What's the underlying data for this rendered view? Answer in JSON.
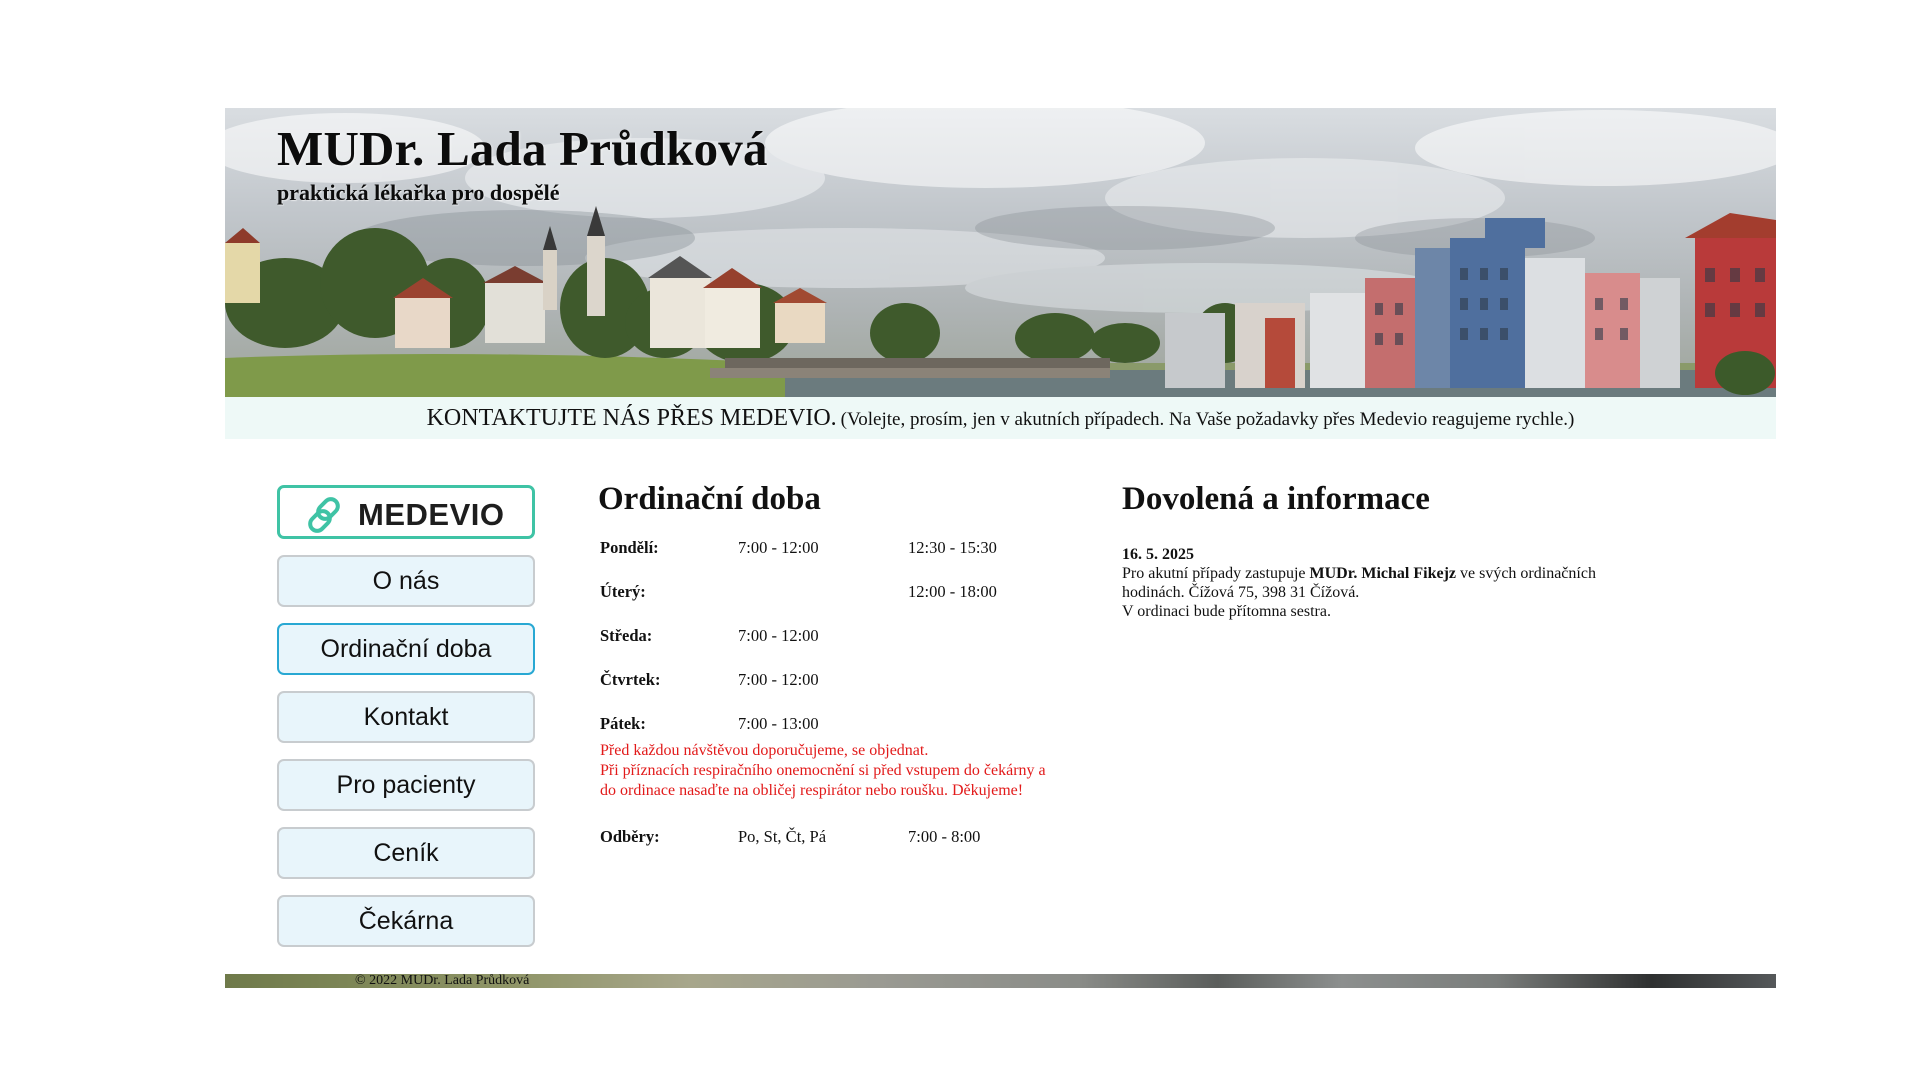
{
  "header": {
    "title": "MUDr. Lada Průdková",
    "subtitle": "praktická lékařka pro dospělé"
  },
  "contact_bar": {
    "lead": "KONTAKTUJTE NÁS PŘES MEDEVIO.",
    "note": "(Volejte, prosím, jen v akutních případech. Na Vaše požadavky přes Medevio reagujeme rychle.)"
  },
  "sidebar": {
    "medevio_label": "MEDEVIO",
    "items": [
      {
        "label": "O nás"
      },
      {
        "label": "Ordinační doba",
        "active": true
      },
      {
        "label": "Kontakt"
      },
      {
        "label": "Pro pacienty"
      },
      {
        "label": "Ceník"
      },
      {
        "label": "Čekárna"
      }
    ]
  },
  "hours": {
    "heading": "Ordinační doba",
    "rows": [
      {
        "day": "Pondělí:",
        "am": "7:00 - 12:00",
        "pm": "12:30 - 15:30"
      },
      {
        "day": "Úterý:",
        "am": "",
        "pm": "12:00 - 18:00"
      },
      {
        "day": "Středa:",
        "am": "7:00 - 12:00",
        "pm": ""
      },
      {
        "day": "Čtvrtek:",
        "am": "7:00 - 12:00",
        "pm": ""
      },
      {
        "day": "Pátek:",
        "am": "7:00 - 13:00",
        "pm": ""
      }
    ],
    "warning_lines": [
      "Před každou návštěvou doporučujeme, se objednat.",
      "Při příznacích respiračního onemocnění si před vstupem do čekárny a",
      "do ordinace nasaďte na obličej respirátor nebo roušku. Děkujeme!"
    ],
    "odbery": {
      "label": "Odběry:",
      "days": "Po, St, Čt, Pá",
      "time": "7:00 - 8:00"
    }
  },
  "news": {
    "heading": "Dovolená a informace",
    "date": "16. 5. 2025",
    "text_before": "Pro akutní případy zastupuje ",
    "doctor": "MUDr. Michal Fikejz",
    "text_after": " ve svých ordinačních hodinách. Čížová 75, 398 31 Čížová.",
    "line2": "V ordinaci bude přítomna sestra."
  },
  "footer": {
    "copyright": "© 2022 MUDr. Lada Průdková"
  },
  "colors": {
    "accent_medevio": "#3fc3a5",
    "active_border": "#28a8d3",
    "nav_bg": "#e8f5fb",
    "contact_bar_bg": "#eef9f7",
    "warning": "#e21a1a"
  }
}
